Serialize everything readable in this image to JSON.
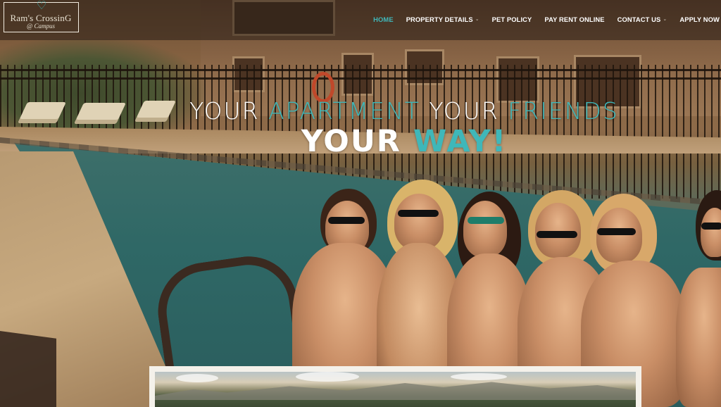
{
  "logo": {
    "name": "Ram's CrossinG",
    "sub": "@ Campus",
    "icon": "heart-ram-icon",
    "accent": "#3fb7b9"
  },
  "nav": {
    "items": [
      {
        "label": "HOME",
        "active": true,
        "dropdown": false
      },
      {
        "label": "PROPERTY DETAILS",
        "active": false,
        "dropdown": true
      },
      {
        "label": "PET POLICY",
        "active": false,
        "dropdown": false
      },
      {
        "label": "PAY RENT ONLINE",
        "active": false,
        "dropdown": false
      },
      {
        "label": "CONTACT US",
        "active": false,
        "dropdown": true
      },
      {
        "label": "APPLY NOW",
        "active": false,
        "dropdown": false
      }
    ]
  },
  "hero": {
    "line1": [
      {
        "text": "YOUR ",
        "accent": false
      },
      {
        "text": "APARTMENT ",
        "accent": true
      },
      {
        "text": "YOUR ",
        "accent": false
      },
      {
        "text": "FRIENDS",
        "accent": true
      }
    ],
    "line2": [
      {
        "text": "YOUR ",
        "accent": false
      },
      {
        "text": "WAY!",
        "accent": true
      }
    ]
  },
  "colors": {
    "accent": "#3fb7b9",
    "text": "#ffffff"
  }
}
